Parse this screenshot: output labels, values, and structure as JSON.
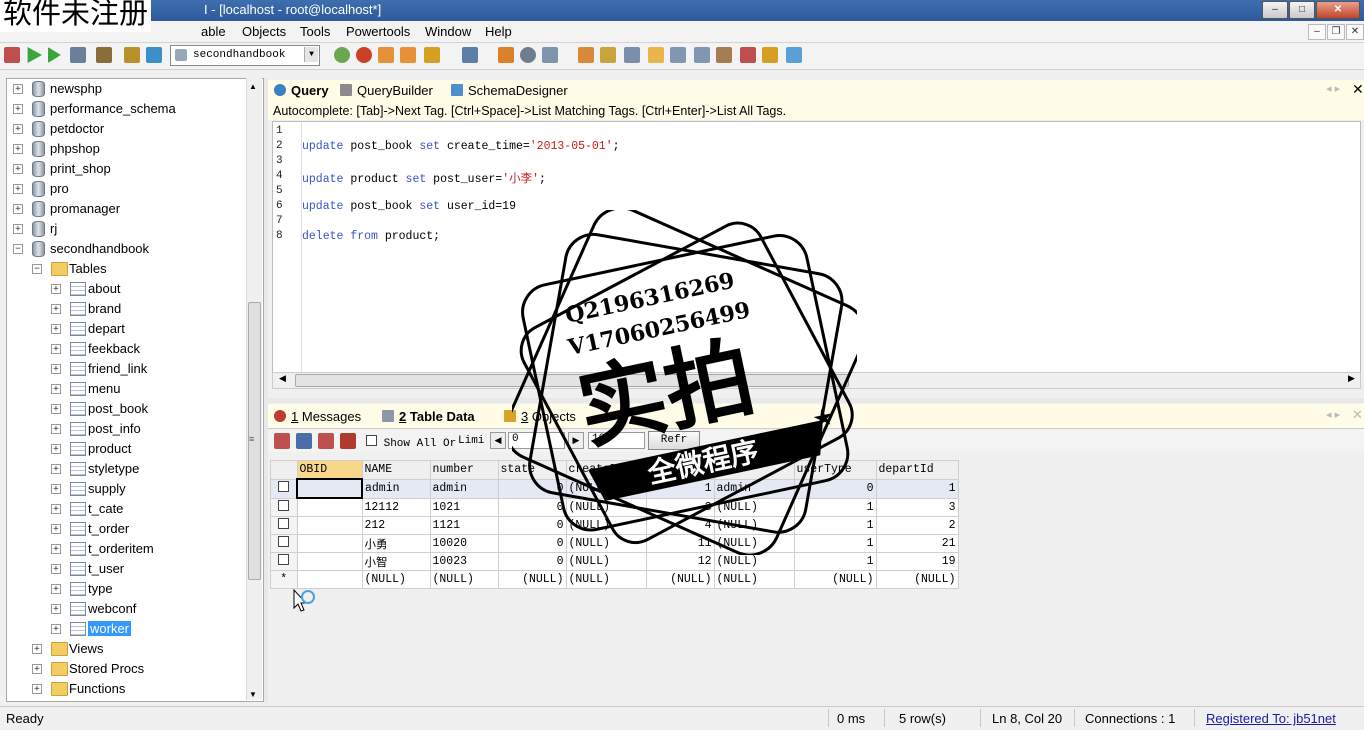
{
  "watermark": "软件未注册",
  "window": {
    "title": "I - [localhost - root@localhost*]",
    "min": "–",
    "max": "□",
    "close": "✕"
  },
  "menu": [
    "able",
    "Objects",
    "Tools",
    "Powertools",
    "Window",
    "Help"
  ],
  "toolbar": {
    "db_selected": "secondhandbook"
  },
  "tree": {
    "databases_top": [
      "newsphp",
      "performance_schema",
      "petdoctor",
      "phpshop",
      "print_shop",
      "pro",
      "promanager",
      "rj"
    ],
    "open_db": "secondhandbook",
    "tables_label": "Tables",
    "tables": [
      "about",
      "brand",
      "depart",
      "feekback",
      "friend_link",
      "menu",
      "post_book",
      "post_info",
      "product",
      "styletype",
      "supply",
      "t_cate",
      "t_order",
      "t_orderitem",
      "t_user",
      "type",
      "webconf",
      "worker"
    ],
    "selected_table": "worker",
    "folders": [
      "Views",
      "Stored Procs",
      "Functions"
    ]
  },
  "query_tabs": [
    "Query",
    "QueryBuilder",
    "SchemaDesigner"
  ],
  "autocomplete_hint": "Autocomplete: [Tab]->Next Tag. [Ctrl+Space]->List Matching Tags. [Ctrl+Enter]->List All Tags.",
  "editor": {
    "line_numbers": [
      "1",
      "2",
      "3",
      "4",
      "5",
      "6",
      "7",
      "8"
    ],
    "lines": [
      {
        "line": "2",
        "kw1": "update",
        "t1": " post_book ",
        "kw2": "set",
        "t2": " create_time=",
        "str": "'2013-05-01'",
        "t3": ";"
      },
      {
        "line": "4",
        "kw1": "update",
        "t1": " product ",
        "kw2": "set",
        "t2": " post_user=",
        "str": "'小李'",
        "t3": ";"
      },
      {
        "line": "6",
        "kw1": "update",
        "t1": " post_book ",
        "kw2": "set",
        "t2": " user_id=19",
        "str": "",
        "t3": ""
      },
      {
        "line": "8",
        "kw1": "delete",
        "t1": " ",
        "kw2": "from",
        "t2": " product;",
        "str": "",
        "t3": ""
      }
    ]
  },
  "result_tabs": [
    {
      "num": "1",
      "label": "Messages"
    },
    {
      "num": "2",
      "label": "Table Data"
    },
    {
      "num": "3",
      "label": "Objects"
    }
  ],
  "result_toolbar": {
    "show_all": "Show All",
    "or": "Or",
    "limit": "Limi",
    "limit_from": "0",
    "limit_count": "10",
    "refresh": "Refr"
  },
  "grid": {
    "columns": [
      "OBID",
      "NAME",
      "number",
      "state",
      "createDt",
      "",
      "",
      "userType",
      "departId"
    ],
    "rows": [
      [
        "",
        "admin",
        "admin",
        "0",
        "(NULL",
        "1",
        "admin",
        "0",
        "1"
      ],
      [
        "",
        "12112",
        "1021",
        "0",
        "(NULL)",
        "3",
        "(NULL)",
        "1",
        "3"
      ],
      [
        "",
        "212",
        "1121",
        "0",
        "(NULL)",
        "4",
        "(NULL)",
        "1",
        "2"
      ],
      [
        "",
        "小勇",
        "10020",
        "0",
        "(NULL)",
        "11",
        "(NULL)",
        "1",
        "21"
      ],
      [
        "",
        "小智",
        "10023",
        "0",
        "(NULL)",
        "12",
        "(NULL)",
        "1",
        "19"
      ]
    ],
    "new_row": [
      "",
      "(NULL)",
      "(NULL)",
      "(NULL)",
      "(NULL)",
      "(NULL)",
      "(NULL)",
      "(NULL)",
      "(NULL)"
    ],
    "new_row_marker": "*"
  },
  "stamp": {
    "qq": "Q2196316269",
    "wx": "V17060256499",
    "big": "实拍",
    "banner": "全微程序"
  },
  "status": {
    "ready": "Ready",
    "time": "0 ms",
    "rows": "5 row(s)",
    "pos": "Ln 8, Col 20",
    "conn": "Connections : 1",
    "reg": "Registered To: jb51net"
  },
  "colors": {
    "selection": "#3399ff",
    "keyword": "#3a55c8",
    "string": "#c41c1c",
    "title_bar": "#2c5a9a"
  }
}
